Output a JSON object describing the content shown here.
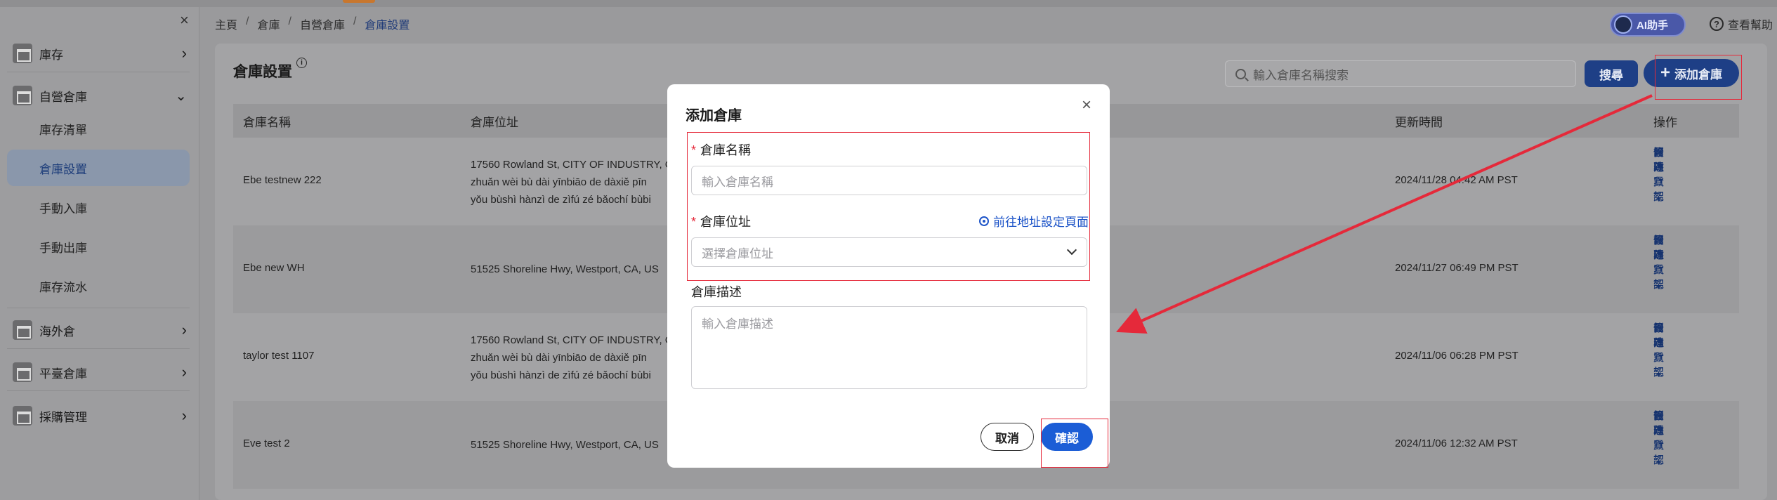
{
  "sidebar": {
    "close": "×",
    "groups": [
      {
        "label": "庫存",
        "chevron": "›"
      },
      {
        "label": "自營倉庫",
        "chevron": "⌄"
      },
      {
        "label": "海外倉",
        "chevron": "›"
      },
      {
        "label": "平臺倉庫",
        "chevron": "›"
      },
      {
        "label": "採購管理",
        "chevron": "›"
      }
    ],
    "sub_items": [
      "庫存清單",
      "倉庫設置",
      "手動入庫",
      "手動出庫",
      "庫存流水"
    ]
  },
  "breadcrumb": {
    "items": [
      "主頁",
      "倉庫",
      "自營倉庫",
      "倉庫設置"
    ],
    "sep": "/"
  },
  "header": {
    "ai_label": "AI助手",
    "help_label": "查看幫助",
    "help_glyph": "?"
  },
  "page": {
    "title": "倉庫設置",
    "info_glyph": "i",
    "search_placeholder": "輸入倉庫名稱搜索",
    "search_button": "搜尋",
    "add_button": "添加倉庫",
    "add_glyph": "+"
  },
  "table": {
    "headers": [
      "倉庫名稱",
      "倉庫位址",
      "更新時間",
      "操作"
    ],
    "rows": [
      {
        "name": "Ebe testnew 222",
        "address": "17560 Rowland St, CITY OF INDUSTRY, C\nzhuǎn wèi bù dài yīnbiāo de dàxiě pīn\nyǒu bùshì hànzì de zìfú zé bǎochí bùbi",
        "time": "2024/11/28 04:42 AM PST"
      },
      {
        "name": "Ebe new WH",
        "address": "51525 Shoreline Hwy, Westport, CA, US",
        "time": "2024/11/27 06:49 PM PST"
      },
      {
        "name": "taylor test 1107",
        "address": "17560 Rowland St, CITY OF INDUSTRY, C\nzhuǎn wèi bù dài yīnbiāo de dàxiě pīn\nyǒu bùshì hànzì de zìfú zé bǎochí bùbi",
        "time": "2024/11/06 06:28 PM PST"
      },
      {
        "name": "Eve test 2",
        "address": "51525 Shoreline Hwy, Westport, CA, US",
        "time": "2024/11/06 12:32 AM PST"
      }
    ],
    "ops": [
      "修改",
      "管理貨架",
      "設為默認",
      "刪除"
    ]
  },
  "modal": {
    "title": "添加倉庫",
    "close": "×",
    "required_mark": "*",
    "name_label": "倉庫名稱",
    "name_placeholder": "輸入倉庫名稱",
    "location_label": "倉庫位址",
    "location_link": "前往地址設定頁面",
    "location_placeholder": "選擇倉庫位址",
    "desc_label": "倉庫描述",
    "desc_placeholder": "輸入倉庫描述",
    "cancel": "取消",
    "confirm": "確認"
  },
  "colors": {
    "primary": "#1e3f86",
    "confirm": "#1b5dd6",
    "highlight": "#e5293a",
    "link": "#1d54c8"
  }
}
